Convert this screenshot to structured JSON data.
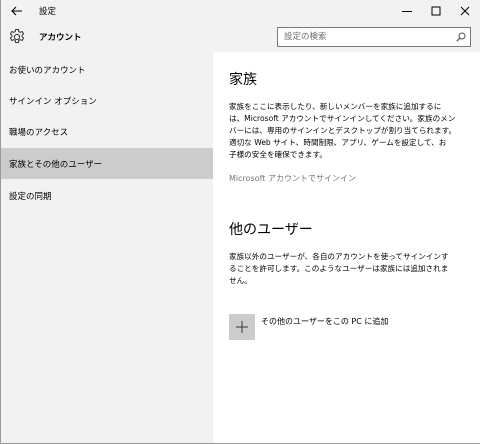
{
  "window": {
    "title": "設定"
  },
  "header": {
    "title": "アカウント"
  },
  "search": {
    "placeholder": "設定の検索"
  },
  "sidebar": {
    "items": [
      {
        "label": "お使いのアカウント"
      },
      {
        "label": "サインイン オプション"
      },
      {
        "label": "職場のアクセス"
      },
      {
        "label": "家族とその他のユーザー",
        "selected": true
      },
      {
        "label": "設定の同期"
      }
    ]
  },
  "family": {
    "heading": "家族",
    "body_lines": [
      "家族をここに表示したり、新しいメンバーを家族に追加するに",
      "は、Microsoft アカウントでサインインしてください。家族のメン",
      "バーには、専用のサインインとデスクトップが割り当てられます。",
      "適切な Web サイト、時間制限、アプリ、ゲームを設定して、お",
      "子様の安全を確保できます。"
    ],
    "signin_link": "Microsoft アカウントでサインイン"
  },
  "other_users": {
    "heading": "他のユーザー",
    "body_lines": [
      "家族以外のユーザーが、各自のアカウントを使ってサインインす",
      "ることを許可します。このようなユーザーは家族には追加されま",
      "せん。"
    ],
    "add_label": "その他のユーザーをこの PC に追加"
  },
  "icons": {
    "back": "back-arrow-icon",
    "gear": "gear-icon",
    "search": "search-icon",
    "add": "plus-icon",
    "minimize": "minimize-icon",
    "maximize": "maximize-icon",
    "close": "close-icon"
  },
  "colors": {
    "chrome_bg": "#f2f2f2",
    "selected_bg": "#cccccc",
    "link_gray": "#767676"
  }
}
